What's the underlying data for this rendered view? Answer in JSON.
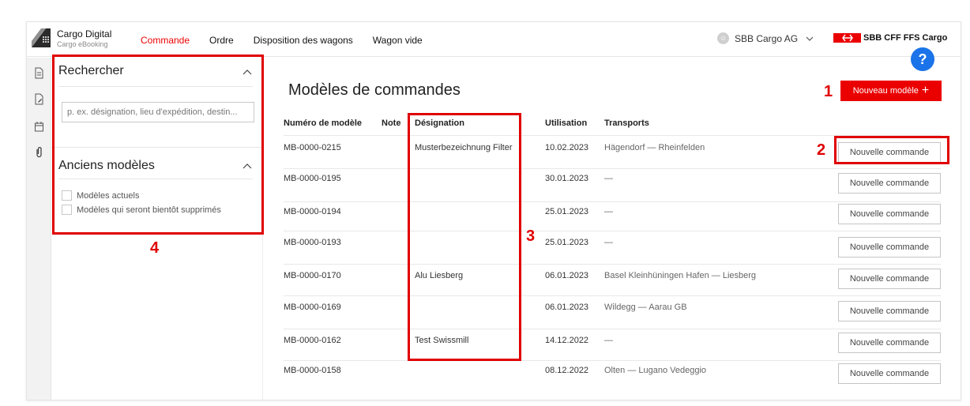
{
  "header": {
    "brand_name": "Cargo Digital",
    "brand_sub": "Cargo eBooking",
    "nav": [
      {
        "label": "Commande",
        "active": true
      },
      {
        "label": "Ordre",
        "active": false
      },
      {
        "label": "Disposition des wagons",
        "active": false
      },
      {
        "label": "Wagon vide",
        "active": false
      }
    ],
    "account_name": "SBB Cargo AG",
    "company_logo_text": "SBB CFF FFS Cargo"
  },
  "rail_icons": [
    "document-icon",
    "document-edit-icon",
    "calendar-icon",
    "paperclip-icon"
  ],
  "filter": {
    "search_title": "Rechercher",
    "search_placeholder": "p. ex. désignation, lieu d'expédition, destin...",
    "old_title": "Anciens modèles",
    "checkboxes": [
      "Modèles actuels",
      "Modèles qui seront bientôt supprimés"
    ]
  },
  "main": {
    "title": "Modèles de commandes",
    "new_button": "Nouveau modèle",
    "help_label": "?",
    "columns": [
      "Numéro de modèle",
      "Note",
      "Désignation",
      "Utilisation",
      "Transports"
    ],
    "order_button": "Nouvelle commande",
    "rows": [
      {
        "number": "MB-0000-0215",
        "note": "",
        "designation": "Musterbezeichnung Filter",
        "usage": "10.02.2023",
        "transports": "Hägendorf — Rheinfelden"
      },
      {
        "number": "MB-0000-0195",
        "note": "",
        "designation": "",
        "usage": "30.01.2023",
        "transports": "—"
      },
      {
        "number": "MB-0000-0194",
        "note": "",
        "designation": "",
        "usage": "25.01.2023",
        "transports": "—"
      },
      {
        "number": "MB-0000-0193",
        "note": "",
        "designation": "",
        "usage": "25.01.2023",
        "transports": "—"
      },
      {
        "number": "MB-0000-0170",
        "note": "",
        "designation": "Alu Liesberg",
        "usage": "06.01.2023",
        "transports": "Basel Kleinhüningen Hafen — Liesberg"
      },
      {
        "number": "MB-0000-0169",
        "note": "",
        "designation": "",
        "usage": "06.01.2023",
        "transports": "Wildegg — Aarau GB"
      },
      {
        "number": "MB-0000-0162",
        "note": "",
        "designation": "Test Swissmill",
        "usage": "14.12.2022",
        "transports": "—"
      },
      {
        "number": "MB-0000-0158",
        "note": "",
        "designation": "",
        "usage": "08.12.2022",
        "transports": "Olten — Lugano Vedeggio"
      }
    ]
  },
  "annotations": [
    "1",
    "2",
    "3",
    "4"
  ],
  "colors": {
    "accent": "#eb0000",
    "annotation": "#e00000",
    "help": "#1a73e8"
  }
}
